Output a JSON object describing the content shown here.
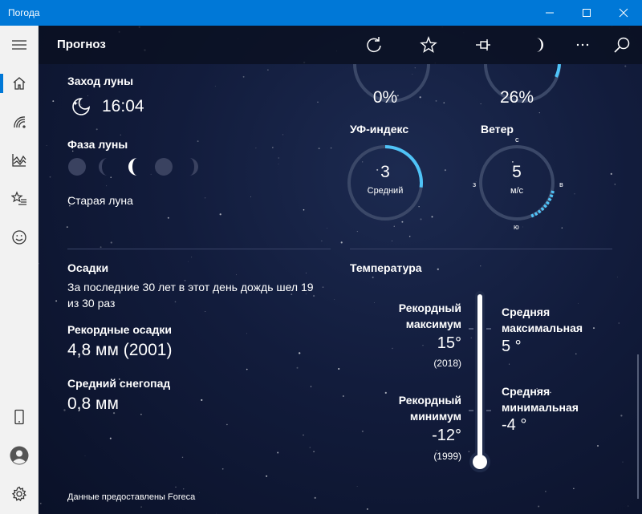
{
  "window": {
    "title": "Погода",
    "minimize_icon": "minimize-icon",
    "maximize_icon": "maximize-icon",
    "close_icon": "close-icon"
  },
  "header": {
    "title": "Прогноз"
  },
  "moon": {
    "moonset_label": "Заход луны",
    "moonset_time": "16:04",
    "phase_label": "Фаза луны",
    "phase_name": "Старая луна"
  },
  "top_gauges": {
    "left_value": "0%",
    "right_value": "26%",
    "right_fraction": 0.26
  },
  "uv": {
    "label": "УФ-индекс",
    "value": "3",
    "level": "Средний",
    "fraction": 0.27
  },
  "wind": {
    "label": "Ветер",
    "value": "5",
    "unit": "м/с",
    "n": "с",
    "e": "в",
    "s": "ю",
    "w": "з"
  },
  "precip": {
    "label": "Осадки",
    "text": "За последние 30 лет в этот день дождь шел 19 из 30 раз",
    "record_label": "Рекордные осадки",
    "record_value": "4,8 мм (2001)",
    "snow_label": "Средний снегопад",
    "snow_value": "0,8 мм"
  },
  "temperature": {
    "label": "Температура",
    "record_max_label": "Рекордный максимум",
    "record_max_value": "15°",
    "record_max_year": "(2018)",
    "record_min_label": "Рекордный минимум",
    "record_min_value": "-12°",
    "record_min_year": "(1999)",
    "avg_max_label": "Средняя максимальная",
    "avg_max_value": "5 °",
    "avg_min_label": "Средняя минимальная",
    "avg_min_value": "-4 °"
  },
  "footer": {
    "credit": "Данные предоставлены Foreca"
  },
  "colors": {
    "accent": "#0078d7",
    "gauge_fill": "#4fc3f7",
    "gauge_track": "#3b4868"
  }
}
